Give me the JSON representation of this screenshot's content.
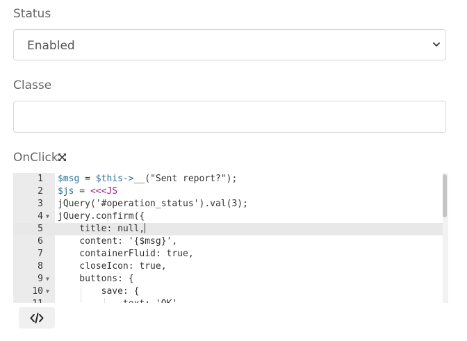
{
  "status": {
    "label": "Status",
    "selected": "Enabled"
  },
  "classe": {
    "label": "Classe",
    "value": ""
  },
  "onclick": {
    "label": "OnClick",
    "lines": [
      {
        "num": "1",
        "fold": false,
        "tokens": [
          {
            "t": "var",
            "s": "$msg"
          },
          {
            "t": "plain",
            "s": " = "
          },
          {
            "t": "var",
            "s": "$this->"
          },
          {
            "t": "plain",
            "s": "__(\"Sent report?\");"
          }
        ]
      },
      {
        "num": "2",
        "fold": false,
        "tokens": [
          {
            "t": "var",
            "s": "$js"
          },
          {
            "t": "plain",
            "s": " = "
          },
          {
            "t": "kw",
            "s": "<<<JS"
          }
        ]
      },
      {
        "num": "3",
        "fold": false,
        "tokens": [
          {
            "t": "plain",
            "s": "jQuery('#operation_status').val(3);"
          }
        ]
      },
      {
        "num": "4",
        "fold": true,
        "tokens": [
          {
            "t": "plain",
            "s": "jQuery.confirm({"
          }
        ]
      },
      {
        "num": "5",
        "fold": false,
        "active": true,
        "tokens": [
          {
            "t": "plain",
            "s": "    title: null,"
          }
        ]
      },
      {
        "num": "6",
        "fold": false,
        "tokens": [
          {
            "t": "plain",
            "s": "    content: '{$msg}',"
          }
        ]
      },
      {
        "num": "7",
        "fold": false,
        "tokens": [
          {
            "t": "plain",
            "s": "    containerFluid: true,"
          }
        ]
      },
      {
        "num": "8",
        "fold": false,
        "tokens": [
          {
            "t": "plain",
            "s": "    closeIcon: true,"
          }
        ]
      },
      {
        "num": "9",
        "fold": true,
        "tokens": [
          {
            "t": "plain",
            "s": "    buttons: {"
          }
        ]
      },
      {
        "num": "10",
        "fold": true,
        "tokens": [
          {
            "t": "plain",
            "s": "        save: {"
          }
        ]
      },
      {
        "num": "11",
        "fold": false,
        "tokens": [
          {
            "t": "plain",
            "s": "            text: 'OK',"
          }
        ]
      }
    ]
  },
  "icons": {
    "select_chevron": "chevron-down-icon",
    "expand": "expand-arrows-icon",
    "code_toggle": "code-icon"
  }
}
